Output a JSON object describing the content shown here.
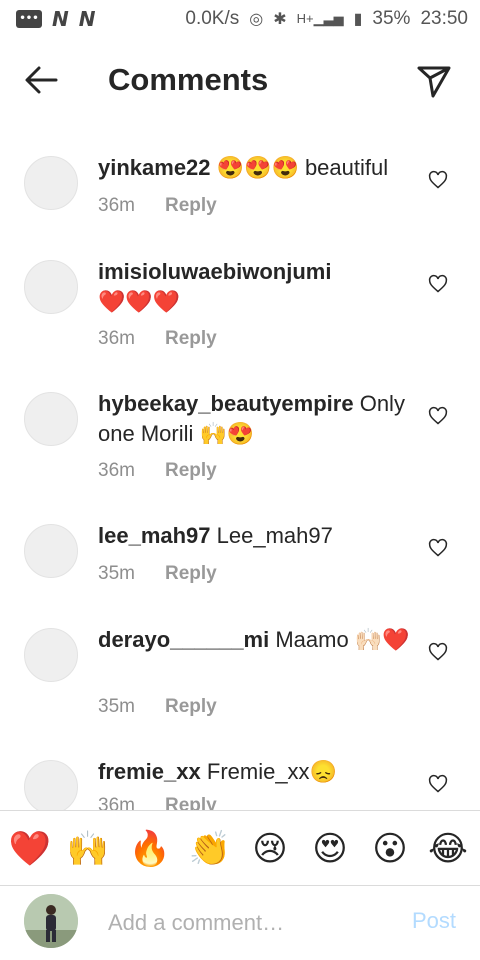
{
  "status_bar": {
    "speed": "0.0K/s",
    "network": "H+",
    "battery": "35%",
    "time": "23:50"
  },
  "header": {
    "title": "Comments"
  },
  "comments": [
    {
      "username": "yinkame22",
      "text": "😍😍😍 beautiful",
      "time": "36m",
      "reply_label": "Reply"
    },
    {
      "username": "imisioluwaebiwonjumi",
      "text": "❤️❤️❤️",
      "time": "36m",
      "reply_label": "Reply"
    },
    {
      "username": "hybeekay_beautyempire",
      "text": "Only one Morili 🙌😍",
      "time": "36m",
      "reply_label": "Reply"
    },
    {
      "username": "lee_mah97",
      "text": "Lee_mah97",
      "time": "35m",
      "reply_label": "Reply"
    },
    {
      "username": "derayo______mi",
      "text": "Maamo 🙌🏻❤️",
      "time": "35m",
      "reply_label": "Reply"
    },
    {
      "username": "fremie_xx",
      "text": "Fremie_xx😞",
      "time": "36m",
      "reply_label": "Reply"
    }
  ],
  "emoji_bar": [
    "❤️",
    "🙌",
    "🔥",
    "👏",
    "😢",
    "😍",
    "😮",
    "😂"
  ],
  "composer": {
    "placeholder": "Add a comment…",
    "post_label": "Post"
  },
  "colors": {
    "post_disabled": "#b3dbff",
    "heart_outline": "#262626",
    "meta_gray": "#8e8e8e"
  }
}
